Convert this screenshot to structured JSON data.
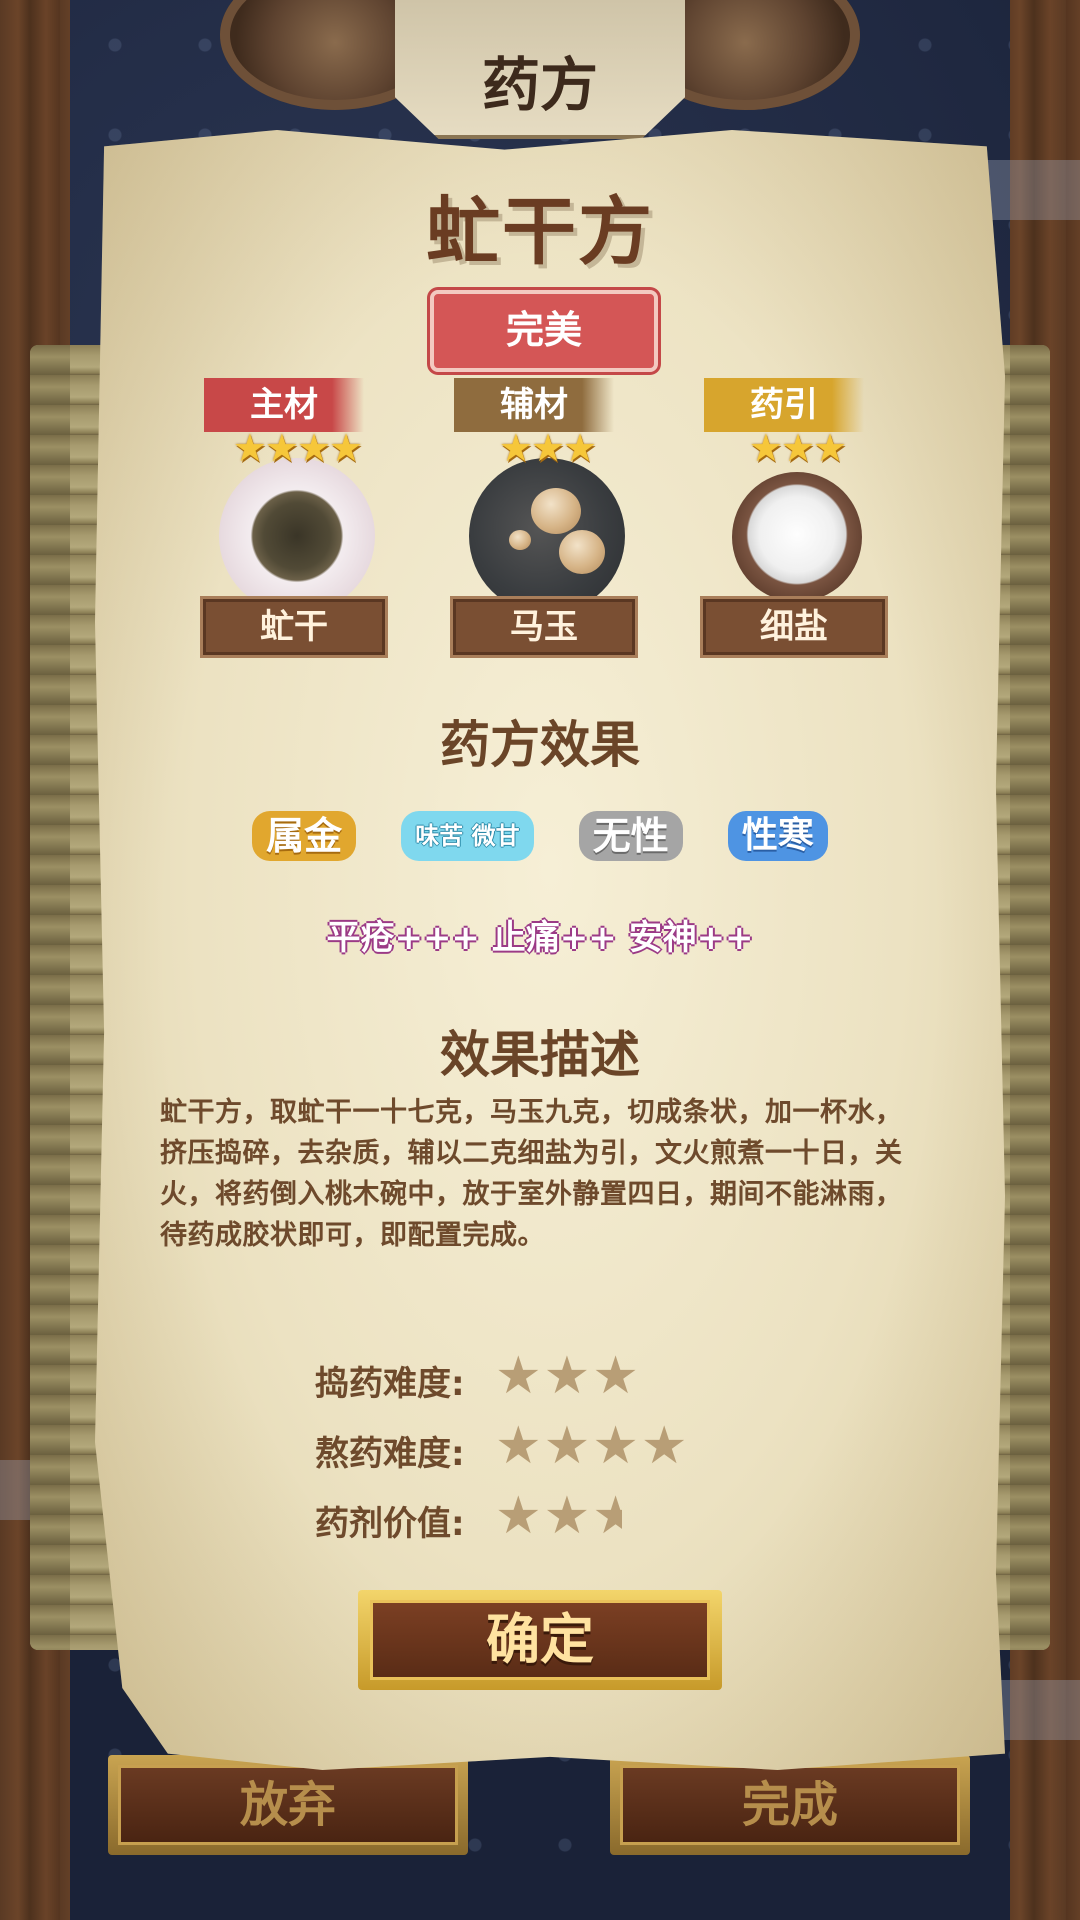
{
  "header": {
    "title": "药方"
  },
  "recipe": {
    "name": "虻干方",
    "quality": "完美"
  },
  "ingredients": [
    {
      "role": "主材",
      "name": "虻干",
      "stars": "★★★★",
      "role_color": "#c84848"
    },
    {
      "role": "辅材",
      "name": "马玉",
      "stars": "★★★",
      "role_color": "#8f6c3e"
    },
    {
      "role": "药引",
      "name": "细盐",
      "stars": "★★★",
      "role_color": "#d7a52d"
    }
  ],
  "effect_section": {
    "title": "药方效果",
    "tags": [
      "属金",
      "味苦 微甘",
      "无性",
      "性寒"
    ],
    "effects": "平疮+++ 止痛++ 安神++"
  },
  "description_section": {
    "title": "效果描述",
    "text": "虻干方，取虻干一十七克，马玉九克，切成条状，加一杯水，挤压捣碎，去杂质，辅以二克细盐为引，文火煎煮一十日，关火，将药倒入桃木碗中，放于室外静置四日，期间不能淋雨，待药成胶状即可，即配置完成。"
  },
  "ratings": [
    {
      "label": "捣药难度:",
      "value": 3,
      "max": 5
    },
    {
      "label": "熬药难度:",
      "value": 4,
      "max": 5
    },
    {
      "label": "药剂价值:",
      "value": 2.5,
      "max": 5
    }
  ],
  "buttons": {
    "confirm": "确定",
    "abandon": "放弃",
    "complete": "完成"
  },
  "colors": {
    "star_gold": "#f6c73a",
    "rating_star": "#b89e76",
    "effect_outline": "#9b3a86"
  }
}
